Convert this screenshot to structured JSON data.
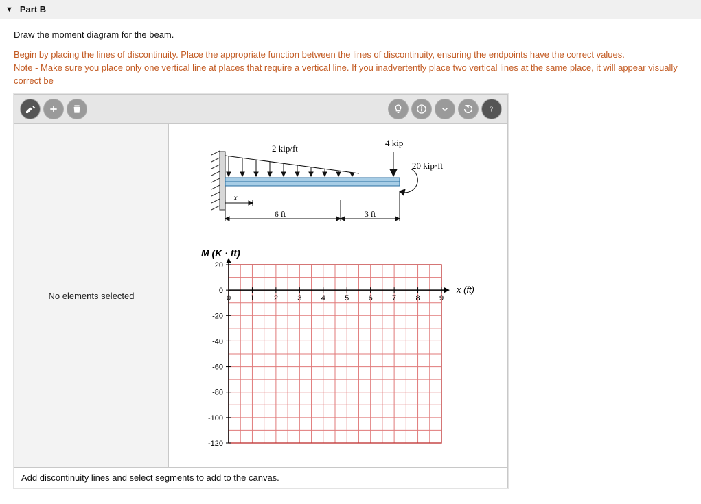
{
  "header": {
    "part_label": "Part B"
  },
  "instructions": {
    "line1": "Draw the moment diagram for the beam.",
    "line2a": "Begin by placing the lines of discontinuity. Place the appropriate function between the lines of discontinuity, ensuring the endpoints have the correct values.",
    "line2b": "Note - Make sure you place only one vertical line at places that require a vertical line. If you inadvertently place two vertical lines at the same place, it will appear visually correct be"
  },
  "toolbar": {
    "draw_label": "draw",
    "add_label": "add",
    "delete_label": "delete",
    "hint_label": "hint",
    "info_label": "info",
    "more_label": "more",
    "reset_label": "reset",
    "help_label": "help"
  },
  "left_panel": {
    "caption": "No elements selected"
  },
  "beam": {
    "dist_load": "2 kip/ft",
    "point_load": "4 kip",
    "moment_load": "20 kip·ft",
    "span1": "6 ft",
    "span2": "3 ft",
    "x_var": "x"
  },
  "chart_data": {
    "type": "line",
    "title": "",
    "y_axis_title": "M (K · ft)",
    "x_axis_title": "x (ft)",
    "xlim": [
      0,
      9
    ],
    "ylim": [
      -120,
      20
    ],
    "x_ticks": [
      0,
      1,
      2,
      3,
      4,
      5,
      6,
      7,
      8,
      9
    ],
    "y_ticks": [
      20,
      0,
      -20,
      -40,
      -60,
      -80,
      -100,
      -120
    ],
    "x_gridlines": [
      0,
      0.5,
      1,
      1.5,
      2,
      2.5,
      3,
      3.5,
      4,
      4.5,
      5,
      5.5,
      6,
      6.5,
      7,
      7.5,
      8,
      8.5,
      9
    ],
    "y_gridlines": [
      20,
      10,
      0,
      -10,
      -20,
      -30,
      -40,
      -50,
      -60,
      -70,
      -80,
      -90,
      -100,
      -110,
      -120
    ],
    "series": []
  },
  "footer": {
    "msg": "Add discontinuity lines and select segments to add to the canvas."
  }
}
